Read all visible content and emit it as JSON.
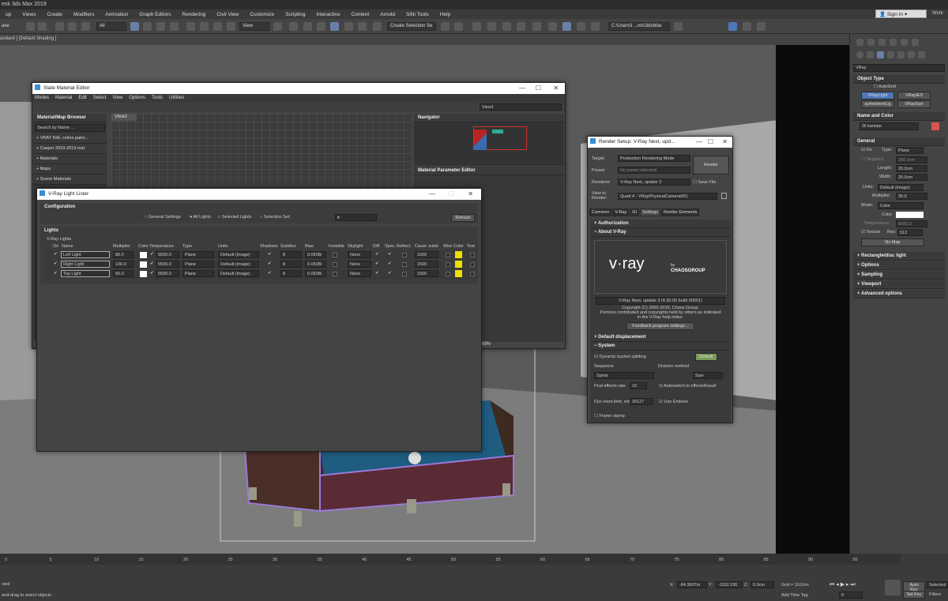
{
  "app": {
    "title": "esk 3ds Max 2019",
    "workspace": "Work"
  },
  "menu": [
    "up",
    "Views",
    "Create",
    "Modifiers",
    "Animation",
    "Graph Editors",
    "Rendering",
    "Civil View",
    "Customize",
    "Scripting",
    "Interactive",
    "Content",
    "Arnold",
    "SiNi Tools",
    "Help"
  ],
  "signin": "Sign In",
  "toolbar": {
    "save": "ave",
    "filter": "All",
    "refcoord": "View",
    "selset": "Create Selection Se",
    "path": "C:\\Users\\l ...nts\\3dsMax"
  },
  "viewport_label": "andard ] [Default Shading ]",
  "slate": {
    "title": "Slate Material Editor",
    "menu": [
      "Modes",
      "Material",
      "Edit",
      "Select",
      "View",
      "Options",
      "Tools",
      "Utilities"
    ],
    "view_dropdown": "View1",
    "tab": "View1",
    "browser_title": "Material/Map Browser",
    "search": "Search by Name ...",
    "groups": [
      "+ VRAY RAL colors paint...",
      "+ Casper 2019-2019.mat",
      "+ Materials",
      "+ Maps",
      "+ Scene Materials"
    ],
    "navigator": "Navigator",
    "param_editor": "Material Parameter Editor",
    "zoom": "89%"
  },
  "lister": {
    "title": "V-Ray Light Lister",
    "configuration": "Configuration",
    "options": [
      "General Settings",
      "All Lights",
      "Selected Lights",
      "Selection Set:"
    ],
    "refresh": "Refresh",
    "lights_section": "Lights",
    "vray_lights": "V-Ray Lights",
    "headers": [
      "On",
      "Name",
      "Multiplier",
      "Color",
      "Temperature",
      "Type",
      "Units",
      "Shadows",
      "Subdivs",
      "Bias",
      "Invisible",
      "Skylight",
      "Diff.",
      "Spec.",
      "Reflect.",
      "Caust. subd.",
      "Wire Color",
      "Text"
    ],
    "rows": [
      {
        "name": "Left Light",
        "mult": "80.0",
        "temp": "5500.0",
        "type": "Plane",
        "units": "Default (image)",
        "subdivs": "8",
        "bias": "0.0508i",
        "sky": "None",
        "caust": "1500"
      },
      {
        "name": "Right Light",
        "mult": "100.0",
        "temp": "5500.0",
        "type": "Plane",
        "units": "Default (image)",
        "subdivs": "8",
        "bias": "0.0508i",
        "sky": "None",
        "caust": "1500"
      },
      {
        "name": "Top Light",
        "mult": "60.0",
        "temp": "5500.0",
        "type": "Plane",
        "units": "Default (image)",
        "subdivs": "8",
        "bias": "0.0508i",
        "sky": "None",
        "caust": "1500"
      }
    ]
  },
  "render": {
    "title": "Render Setup: V-Ray Next, upd...",
    "target_l": "Target:",
    "target": "Production Rendering Mode",
    "preset_l": "Preset:",
    "preset": "No preset selected",
    "renderer_l": "Renderer:",
    "renderer": "V-Ray Next, update 3",
    "savefile": "Save File",
    "viewto_l": "View to Render:",
    "viewto": "Quad 4 - VRayPhysicalCamera001",
    "render_btn": "Render",
    "tabs": [
      "Common",
      "V-Ray",
      "GI",
      "Settings",
      "Render Elements"
    ],
    "auth": "Authorization",
    "about": "About V-Ray",
    "vray_logo": "v·ray",
    "by": "by",
    "chaos": "CHAOSGROUP",
    "version": "V-Ray Next, update 3 (4.30.00 build 00001)",
    "copy1": "Copyright (C) 2000-2019, Chaos Group.",
    "copy2": "Portions contributed and copyrights held by others as indicated",
    "copy3": "in the V-Ray help index.",
    "feedback": "Feedback program settings...",
    "displacement": "Default displacement",
    "system": "System",
    "dyn": "Dynamic bucket splitting",
    "default": "Default",
    "seq_l": "Sequence",
    "seq": "Spiral",
    "div_l": "Division method",
    "div": "Size",
    "post_l": "Post effects rate",
    "post": "10",
    "autoswitch": "Autoswitch to effectsResult",
    "dyn_l": "Dyn mem limit, mb",
    "dynval": "26127",
    "embree": "Use Embree",
    "frame": "Frame stamp"
  },
  "panel": {
    "vray": "VRay",
    "objtype": "Object Type",
    "autogrid": "AutoGrid",
    "btns": [
      "VRayLight",
      "VRayIES",
      "ayAmbientLig",
      "VRaySun"
    ],
    "namecolor": "Name and Color",
    "objname": "2li kanepe",
    "general": "General",
    "on": "On",
    "type_l": "Type:",
    "type": "Plane",
    "targeted": "Targeted",
    "target_v": "200.0cm",
    "length_l": "Length:",
    "length": "20.0cm",
    "width_l": "Width:",
    "width": "20.0cm",
    "units_l": "Units:",
    "units": "Default (image)",
    "mult_l": "Multiplier:",
    "mult": "30.0",
    "mode_l": "Mode:",
    "mode": "Color",
    "color_l": "Color:",
    "temp_l": "Temperature:",
    "temp": "6500.0",
    "texture": "Texture",
    "res_l": "Res:",
    "res": "512",
    "nomap": "No Map",
    "rollouts": [
      "Rectangle/disc light",
      "Options",
      "Sampling",
      "Viewport",
      "Advanced options"
    ]
  },
  "timeline": {
    "ticks": [
      "0",
      "5",
      "10",
      "15",
      "20",
      "25",
      "30",
      "35",
      "40",
      "45",
      "50",
      "55",
      "60",
      "65",
      "70",
      "75",
      "80",
      "85",
      "90",
      "95"
    ],
    "status1": "cted",
    "status2": "and-drag to select objects",
    "x_l": "X:",
    "x": "-84.3697m",
    "y_l": "Y:",
    "y": "-1192.236",
    "z_l": "Z:",
    "z": "0.0cm",
    "grid": "Grid = 10.0cm",
    "addtime": "Add Time Tag",
    "frame": "0",
    "autokey": "Auto Key",
    "selected": "Selected",
    "setkey": "Set Key",
    "filters": "Filters"
  }
}
